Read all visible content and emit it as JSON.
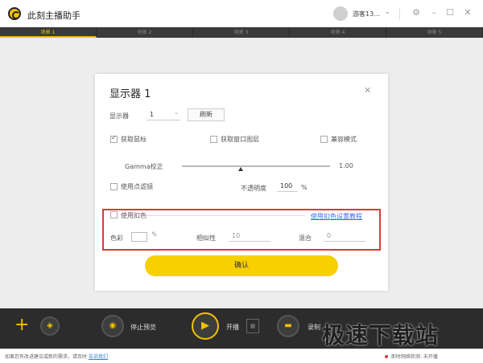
{
  "app": {
    "title": "此刻主播助手"
  },
  "user": {
    "name": "游客13..."
  },
  "scene_tabs": [
    "场景 1",
    "场景 2",
    "场景 3",
    "场景 4",
    "场景 5"
  ],
  "dialog": {
    "title": "显示器 1",
    "monitor_label": "显示器",
    "monitor_value": "1",
    "refresh_label": "刷新",
    "capture_mouse_label": "获取鼠标",
    "capture_layer_label": "获取窗口图层",
    "compat_mode_label": "兼容模式",
    "gamma_label": "Gamma校正",
    "gamma_value": "1.00",
    "point_filter_label": "使用点滤镜",
    "opacity_label": "不透明度",
    "opacity_value": "100",
    "opacity_unit": "%",
    "chroma_label": "使用扣色",
    "chroma_link": "使用扣色设置教程",
    "color_label": "色彩",
    "similarity_label": "相似性",
    "similarity_value": "10",
    "blend_label": "混合",
    "blend_value": "0",
    "confirm_label": "确认"
  },
  "bottom": {
    "stop_preview_label": "停止预览",
    "start_live_label": "开播",
    "record_label": "录制"
  },
  "watermark": "极速下载站",
  "status": {
    "left_text": "如果您有改进建议或新的需求，请及时",
    "left_link": "告诉我们",
    "right_text": "即时网络检测: 未开播"
  },
  "colors": {
    "accent": "#f2c200",
    "highlight_border": "#d63a3a",
    "link": "#2b79d8"
  }
}
